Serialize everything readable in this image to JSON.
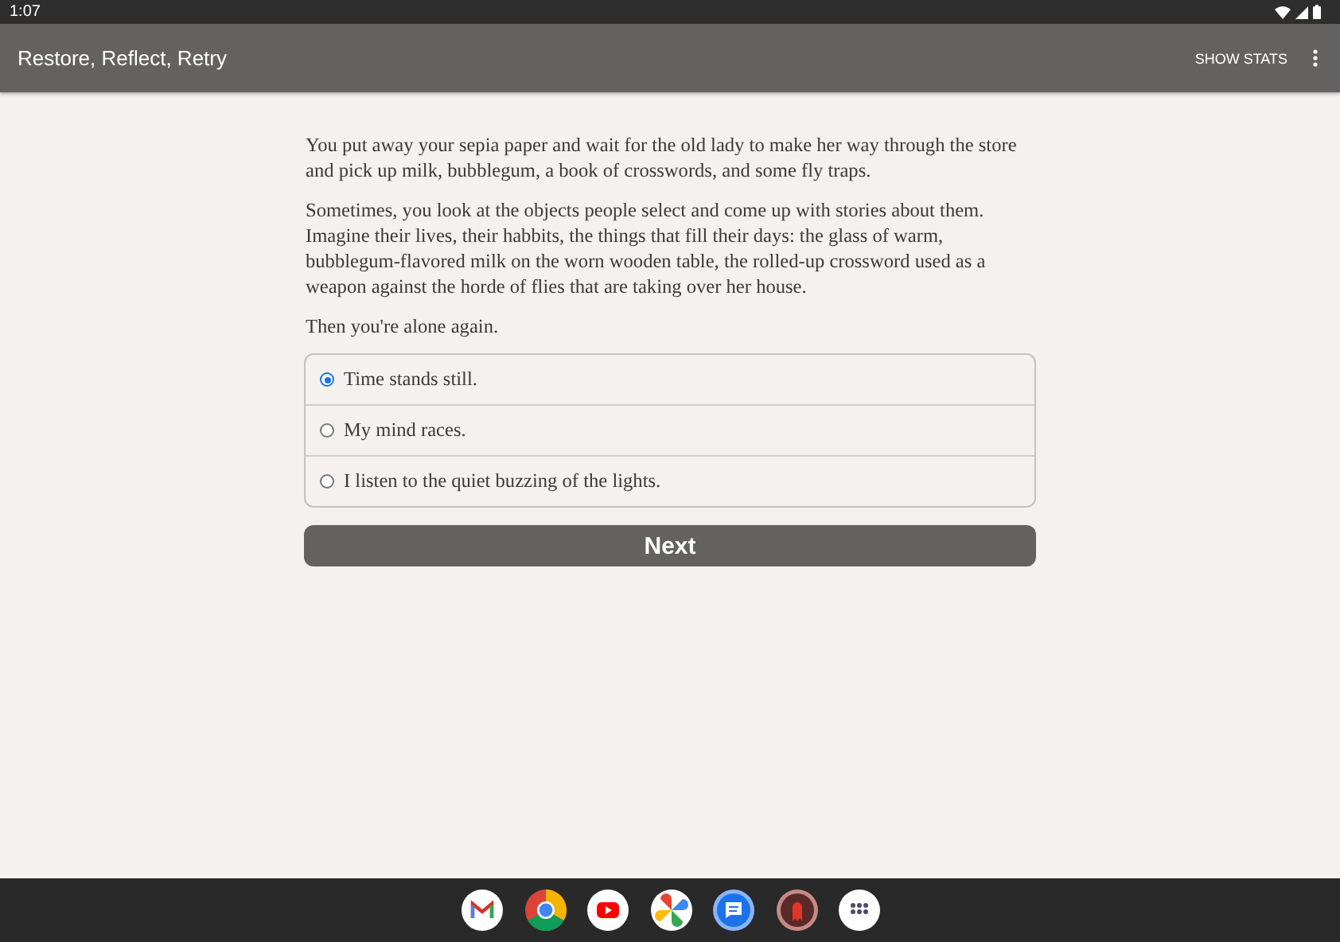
{
  "status_bar": {
    "time": "1:07"
  },
  "app_bar": {
    "title": "Restore, Reflect, Retry",
    "action": "SHOW STATS"
  },
  "paragraphs": [
    "You put away your sepia paper and wait for the old lady to make her way through the store and pick up milk, bubblegum, a book of crosswords, and some fly traps.",
    "Sometimes, you look at the objects people select and come up with stories about them. Imagine their lives, their habbits, the things that fill their days: the glass of warm, bubblegum-flavored milk on the worn wooden table, the rolled-up crossword used as a weapon against the horde of flies that are taking over her house.",
    "Then you're alone again."
  ],
  "choices": [
    {
      "label": "Time stands still.",
      "selected": true
    },
    {
      "label": "My mind races.",
      "selected": false
    },
    {
      "label": "I listen to the quiet buzzing of the lights.",
      "selected": false
    }
  ],
  "next_button": "Next",
  "taskbar": [
    {
      "kind": "mail"
    },
    {
      "kind": "browser"
    },
    {
      "kind": "video"
    },
    {
      "kind": "photos"
    },
    {
      "kind": "messages"
    },
    {
      "kind": "game"
    },
    {
      "kind": "apps"
    }
  ]
}
